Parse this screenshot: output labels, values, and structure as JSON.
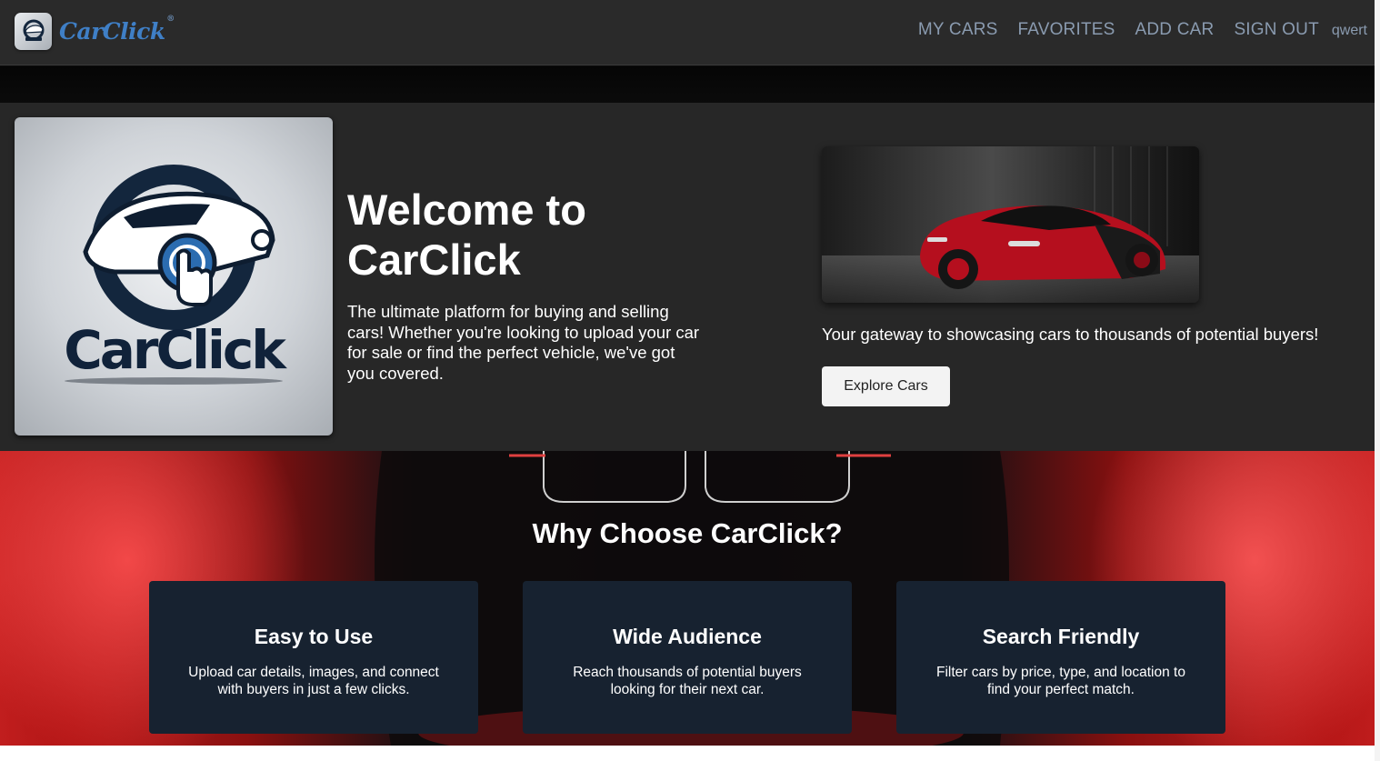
{
  "brand": {
    "name": "CarClick",
    "reg": "®"
  },
  "nav": {
    "items": [
      "MY CARS",
      "FAVORITES",
      "ADD CAR",
      "SIGN OUT"
    ],
    "username": "qwert"
  },
  "hero": {
    "logo_text": "CarClick",
    "title": "Welcome to CarClick",
    "description": "The ultimate platform for buying and selling cars! Whether you're looking to upload your car for sale or find the perfect vehicle, we've got you covered.",
    "gateway": "Your gateway to showcasing cars to thousands of potential buyers!",
    "explore_label": "Explore Cars"
  },
  "why": {
    "title": "Why Choose CarClick?",
    "features": [
      {
        "title": "Easy to Use",
        "text": "Upload car details, images, and connect with buyers in just a few clicks."
      },
      {
        "title": "Wide Audience",
        "text": "Reach thousands of potential buyers looking for their next car."
      },
      {
        "title": "Search Friendly",
        "text": "Filter cars by price, type, and location to find your perfect match."
      }
    ]
  },
  "colors": {
    "brand": "#3f7fc6",
    "nav_link": "#8a9bb0",
    "card": "#172230",
    "accent_red": "#c92424"
  },
  "icons": [
    "carclick-logo-icon",
    "car-photo",
    "car-background-image"
  ]
}
